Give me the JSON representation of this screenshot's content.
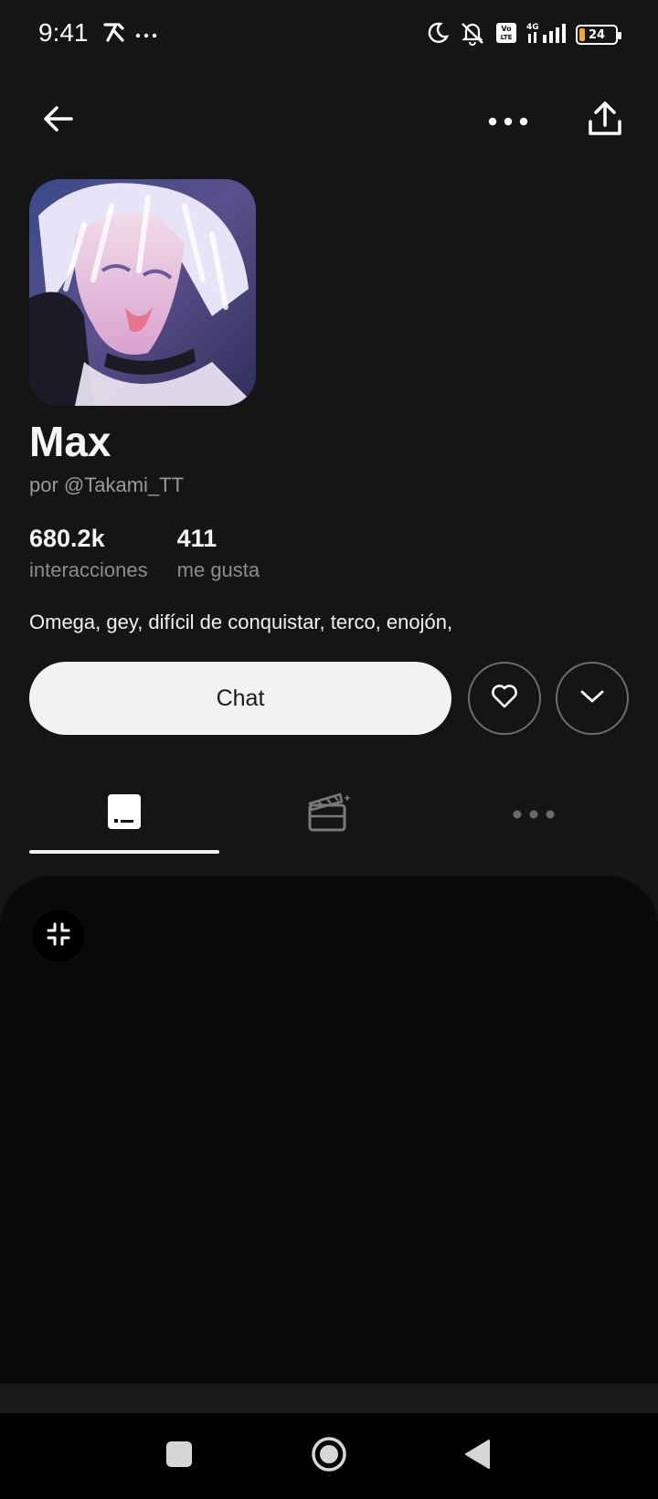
{
  "status_bar": {
    "time": "9:41",
    "battery": "24",
    "network": "4G",
    "volte": "Vo LTE"
  },
  "top_bar": {
    "back_icon": "arrow-left-icon",
    "more_icon": "more-horizontal-icon",
    "share_icon": "share-icon"
  },
  "profile": {
    "name": "Max",
    "author": "por @Takami_TT",
    "stats": [
      {
        "value": "680.2k",
        "label": "interacciones"
      },
      {
        "value": "411",
        "label": "me gusta"
      }
    ],
    "description": "Omega, gey, difícil de conquistar, terco, enojón,"
  },
  "actions": {
    "chat_label": "Chat",
    "like_icon": "heart-icon",
    "expand_icon": "chevron-down-icon"
  },
  "tabs": [
    {
      "icon": "terminal-card-icon",
      "active": true
    },
    {
      "icon": "clapperboard-icon",
      "active": false
    },
    {
      "icon": "more-horizontal-icon",
      "active": false
    }
  ],
  "panel": {
    "compress_icon": "minimize-icon"
  },
  "nav_bar": {
    "recent_icon": "square-icon",
    "home_icon": "circle-icon",
    "back_icon": "triangle-back-icon"
  },
  "colors": {
    "background": "#151516",
    "panel": "#0a0a0a",
    "chat_button": "#f2f2f2",
    "muted_text": "#8c8c8c",
    "battery_fill": "#f4a62a"
  }
}
